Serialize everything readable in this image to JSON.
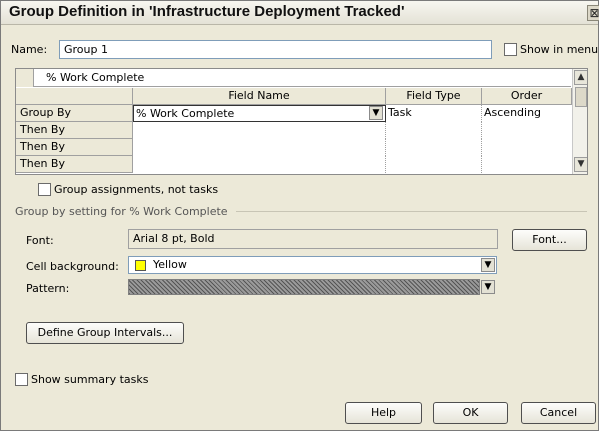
{
  "window": {
    "title": "Group Definition in 'Infrastructure Deployment Tracked'",
    "close_glyph": "⊠"
  },
  "name": {
    "label": "Name:",
    "value": "Group 1"
  },
  "show_in_menu": {
    "label": "Show in menu",
    "checked": false
  },
  "grid": {
    "edit_value": "% Work Complete",
    "columns": [
      "Field Name",
      "Field Type",
      "Order"
    ],
    "rows": [
      {
        "header": "Group By",
        "field_name": "% Work Complete",
        "field_type": "Task",
        "order": "Ascending"
      },
      {
        "header": "Then By",
        "field_name": "",
        "field_type": "",
        "order": ""
      },
      {
        "header": "Then By",
        "field_name": "",
        "field_type": "",
        "order": ""
      },
      {
        "header": "Then By",
        "field_name": "",
        "field_type": "",
        "order": ""
      }
    ]
  },
  "group_assignments": {
    "label": "Group assignments, not tasks",
    "checked": false
  },
  "group_setting_title": "Group by setting for % Work Complete",
  "font": {
    "label": "Font:",
    "value": "Arial 8 pt, Bold",
    "button": "Font..."
  },
  "cell_background": {
    "label": "Cell background:",
    "value": "Yellow",
    "color": "#ffff00"
  },
  "pattern": {
    "label": "Pattern:"
  },
  "define_intervals_button": "Define Group Intervals...",
  "show_summary": {
    "label": "Show summary tasks",
    "checked": false
  },
  "buttons": {
    "help": "Help",
    "ok": "OK",
    "cancel": "Cancel"
  }
}
